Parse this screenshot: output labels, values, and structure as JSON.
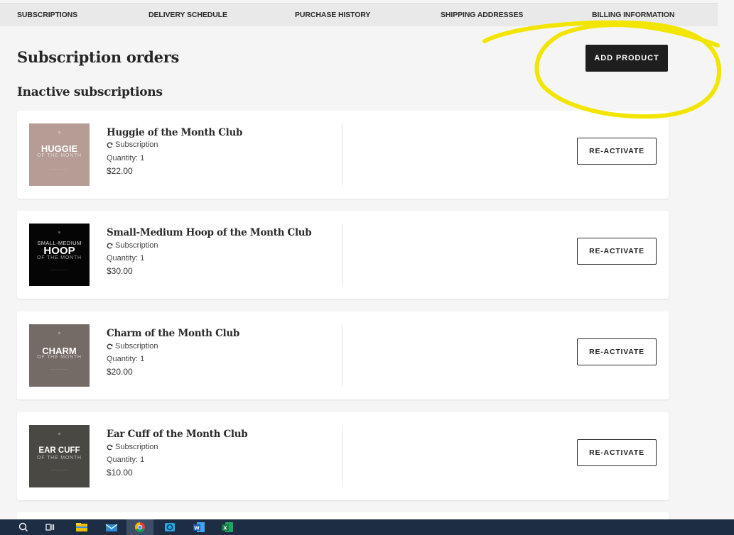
{
  "nav": {
    "items": [
      "SUBSCRIPTIONS",
      "DELIVERY SCHEDULE",
      "PURCHASE HISTORY",
      "SHIPPING ADDRESSES",
      "BILLING INFORMATION"
    ]
  },
  "page": {
    "title": "Subscription orders",
    "section_title": "Inactive subscriptions",
    "add_button_label": "ADD PRODUCT"
  },
  "subscriptions": [
    {
      "name": "Huggie of the Month Club",
      "type": "Subscription",
      "quantity": "Quantity: 1",
      "price": "$22.00",
      "button_label": "RE-ACTIVATE",
      "thumb": {
        "top_text": "",
        "main_text": "HUGGIE",
        "sub_text": "OF THE MONTH",
        "bg": "#b59c95"
      }
    },
    {
      "name": "Small-Medium Hoop of the Month Club",
      "type": "Subscription",
      "quantity": "Quantity: 1",
      "price": "$30.00",
      "button_label": "RE-ACTIVATE",
      "thumb": {
        "top_text": "SMALL-MEDIUM",
        "main_text": "HOOP",
        "sub_text": "OF THE MONTH",
        "bg": "#050505"
      }
    },
    {
      "name": "Charm of the Month Club",
      "type": "Subscription",
      "quantity": "Quantity: 1",
      "price": "$20.00",
      "button_label": "RE-ACTIVATE",
      "thumb": {
        "top_text": "",
        "main_text": "CHARM",
        "sub_text": "OF THE MONTH",
        "bg": "#746a66"
      }
    },
    {
      "name": "Ear Cuff of the Month Club",
      "type": "Subscription",
      "quantity": "Quantity: 1",
      "price": "$10.00",
      "button_label": "RE-ACTIVATE",
      "thumb": {
        "top_text": "",
        "main_text": "EAR CUFF",
        "sub_text": "OF THE MONTH",
        "bg": "#4a4843"
      }
    }
  ],
  "colors": {
    "highlight_marker": "#f2e600",
    "add_button_bg": "#1e1e1e",
    "taskbar_bg": "#1d2d44"
  },
  "taskbar": {
    "icons": [
      "search-icon",
      "task-view-icon",
      "file-explorer-icon",
      "mail-icon",
      "chrome-icon",
      "photos-icon",
      "word-icon",
      "excel-icon"
    ]
  }
}
